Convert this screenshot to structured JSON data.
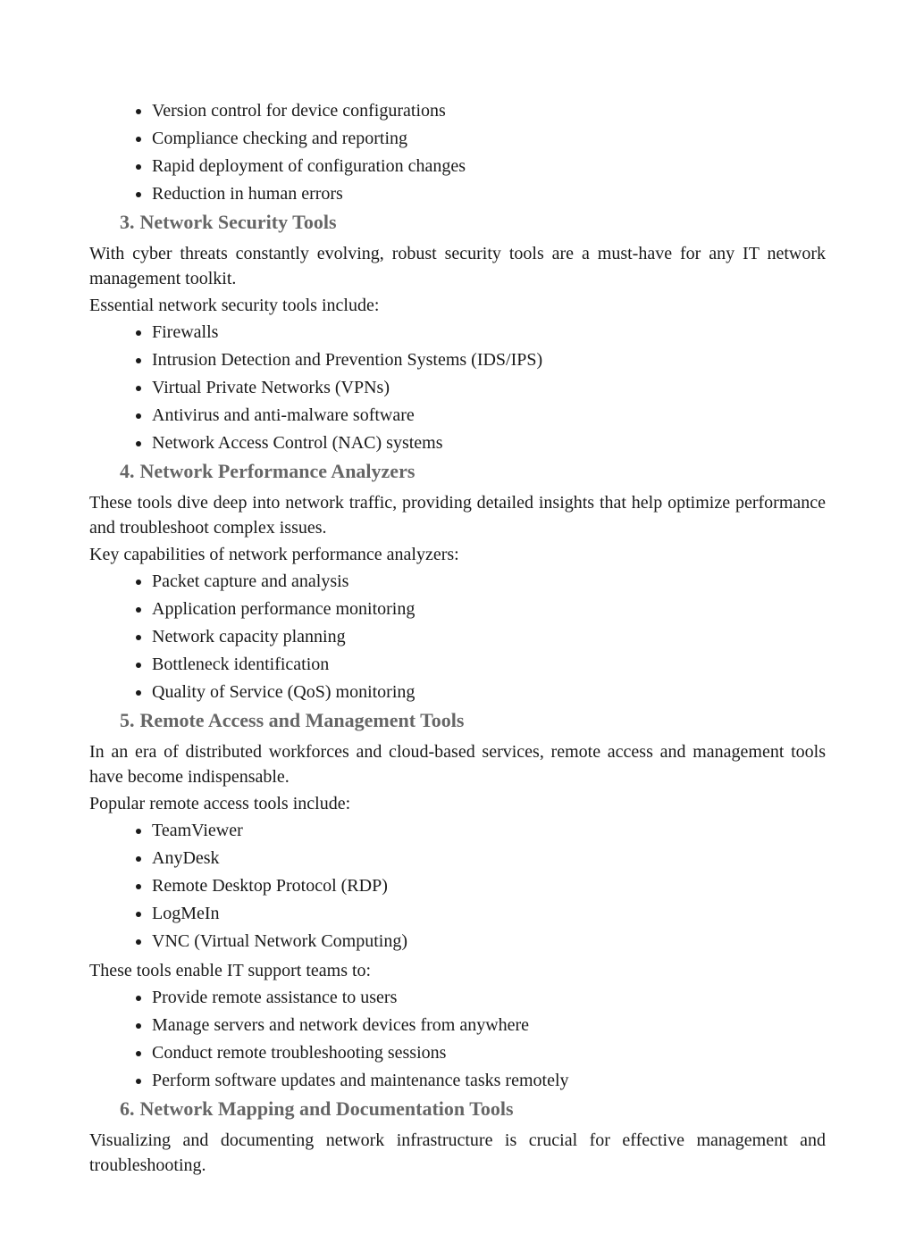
{
  "section2_list": [
    "Version control for device configurations",
    "Compliance checking and reporting",
    "Rapid deployment of configuration changes",
    "Reduction in human errors"
  ],
  "section3": {
    "heading_num": "3.",
    "heading_text": "Network Security Tools",
    "para1": "With cyber threats constantly evolving, robust security tools are a must-have for any IT network management toolkit.",
    "para2": "Essential network security tools include:",
    "list": [
      "Firewalls",
      "Intrusion Detection and Prevention Systems (IDS/IPS)",
      "Virtual Private Networks (VPNs)",
      "Antivirus and anti-malware software",
      "Network Access Control (NAC) systems"
    ]
  },
  "section4": {
    "heading_num": "4.",
    "heading_text": "Network Performance Analyzers",
    "para1": "These tools dive deep into network traffic, providing detailed insights that help optimize performance and troubleshoot complex issues.",
    "para2": "Key capabilities of network performance analyzers:",
    "list": [
      "Packet capture and analysis",
      "Application performance monitoring",
      "Network capacity planning",
      "Bottleneck identification",
      "Quality of Service (QoS) monitoring"
    ]
  },
  "section5": {
    "heading_num": "5.",
    "heading_text": "Remote Access and Management Tools",
    "para1": "In an era of distributed workforces and cloud-based services, remote access and management tools have become indispensable.",
    "para2": "Popular remote access tools include:",
    "list1": [
      "TeamViewer",
      "AnyDesk",
      "Remote Desktop Protocol (RDP)",
      "LogMeIn",
      "VNC (Virtual Network Computing)"
    ],
    "para3": "These tools enable IT support teams to:",
    "list2": [
      "Provide remote assistance to users",
      "Manage servers and network devices from anywhere",
      "Conduct remote troubleshooting sessions",
      "Perform software updates and maintenance tasks remotely"
    ]
  },
  "section6": {
    "heading_num": "6.",
    "heading_text": "Network Mapping and Documentation Tools",
    "para1": "Visualizing and documenting network infrastructure is crucial for effective management and troubleshooting."
  }
}
